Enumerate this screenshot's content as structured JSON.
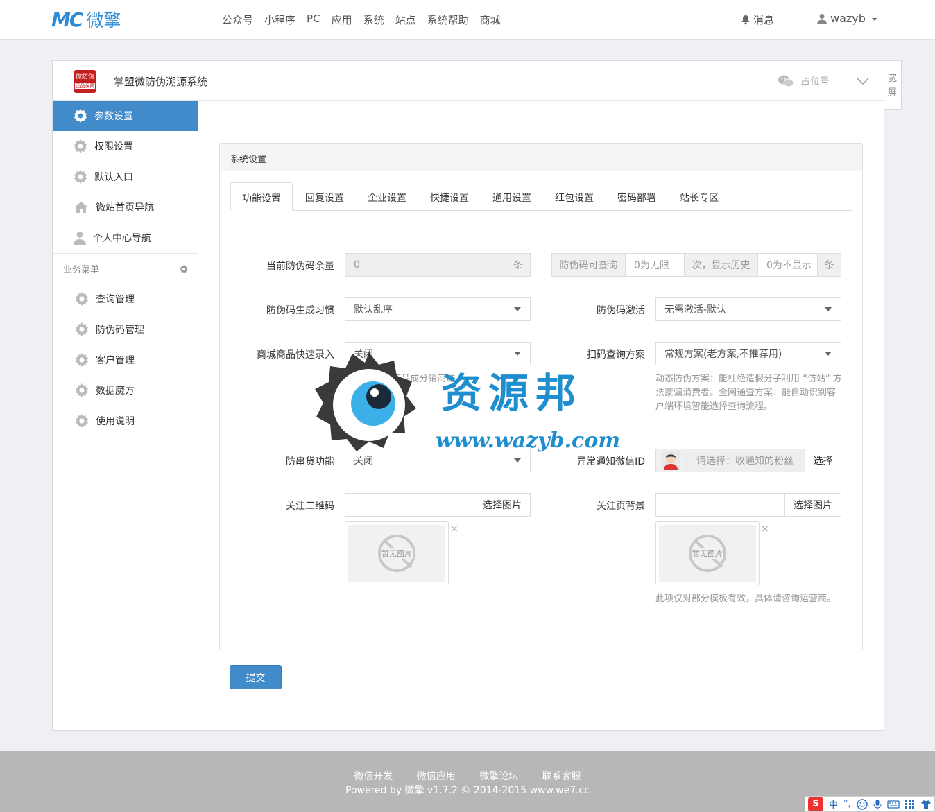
{
  "topbar": {
    "logo_mark": "MC",
    "logo_text": "微擎",
    "nav": [
      "公众号",
      "小程序",
      "PC",
      "应用",
      "系统",
      "站点",
      "系统帮助",
      "商城"
    ],
    "messages": "消息",
    "username": "wazyb"
  },
  "wide_toggle": "宽屏",
  "app": {
    "logo_text_1": "微防伪",
    "logo_text_2": "正品保障",
    "title": "掌盟微防伪溯源系统",
    "account": "占位号"
  },
  "sidebar": {
    "main": [
      {
        "label": "参数设置",
        "icon": "gear-icon",
        "active": true
      },
      {
        "label": "权限设置",
        "icon": "gear-icon"
      },
      {
        "label": "默认入口",
        "icon": "gear-icon"
      },
      {
        "label": "微站首页导航",
        "icon": "home-icon"
      },
      {
        "label": "个人中心导航",
        "icon": "user-icon"
      }
    ],
    "group_title": "业务菜单",
    "group": [
      {
        "label": "查询管理",
        "icon": "gear-icon"
      },
      {
        "label": "防伪码管理",
        "icon": "gear-icon"
      },
      {
        "label": "客户管理",
        "icon": "gear-icon"
      },
      {
        "label": "数据魔方",
        "icon": "gear-icon"
      },
      {
        "label": "使用说明",
        "icon": "gear-icon"
      }
    ]
  },
  "settings": {
    "box_title": "系统设置",
    "tabs": [
      "功能设置",
      "回复设置",
      "企业设置",
      "快捷设置",
      "通用设置",
      "红包设置",
      "密码部署",
      "站长专区"
    ],
    "remaining_label": "当前防伪码余量",
    "remaining_value": "0",
    "remaining_unit": "条",
    "query_prefix": "防伪码可查询",
    "query_placeholder": "0为无限",
    "query_mid": "次，显示历史",
    "history_placeholder": "0为不显示",
    "history_unit": "条",
    "gen_label": "防伪码生成习惯",
    "gen_value": "默认乱序",
    "activate_label": "防伪码激活",
    "activate_value": "无需激活-默认",
    "mall_label": "商城商品快速录入",
    "mall_value": "关闭",
    "mall_help": "一键扫描,商品成分销商城",
    "scan_label": "扫码查询方案",
    "scan_value": "常规方案(老方案,不推荐用)",
    "scan_help": "动态防伪方案：能杜绝造假分子利用 “仿站” 方法蒙骗消费者。全网通查方案：能自动识别客户端环境智能选择查询流程。",
    "anti_label": "防串货功能",
    "anti_value": "关闭",
    "notify_label": "异常通知微信ID",
    "notify_placeholder": "请选择：收通知的粉丝",
    "notify_button": "选择",
    "qr_label": "关注二维码",
    "qr_button": "选择图片",
    "bg_label": "关注页背景",
    "bg_button": "选择图片",
    "no_image": "暂无图片",
    "remove": "×",
    "bg_help": "此项仅对部分模板有效，具体请咨询运营商。",
    "submit": "提交"
  },
  "watermark": {
    "title": "资源邦",
    "url": "www.wazyb.com"
  },
  "footer": {
    "links": [
      "微信开发",
      "微信应用",
      "微擎论坛",
      "联系客服"
    ],
    "copyright": "Powered by 微擎 v1.7.2 © 2014-2015 www.we7.cc"
  },
  "ime": {
    "logo": "S",
    "mode": "中",
    "punct": "°,"
  },
  "colors": {
    "accent": "#428bca",
    "brand": "#2e8bd6",
    "footer": "#b7b7b7"
  }
}
